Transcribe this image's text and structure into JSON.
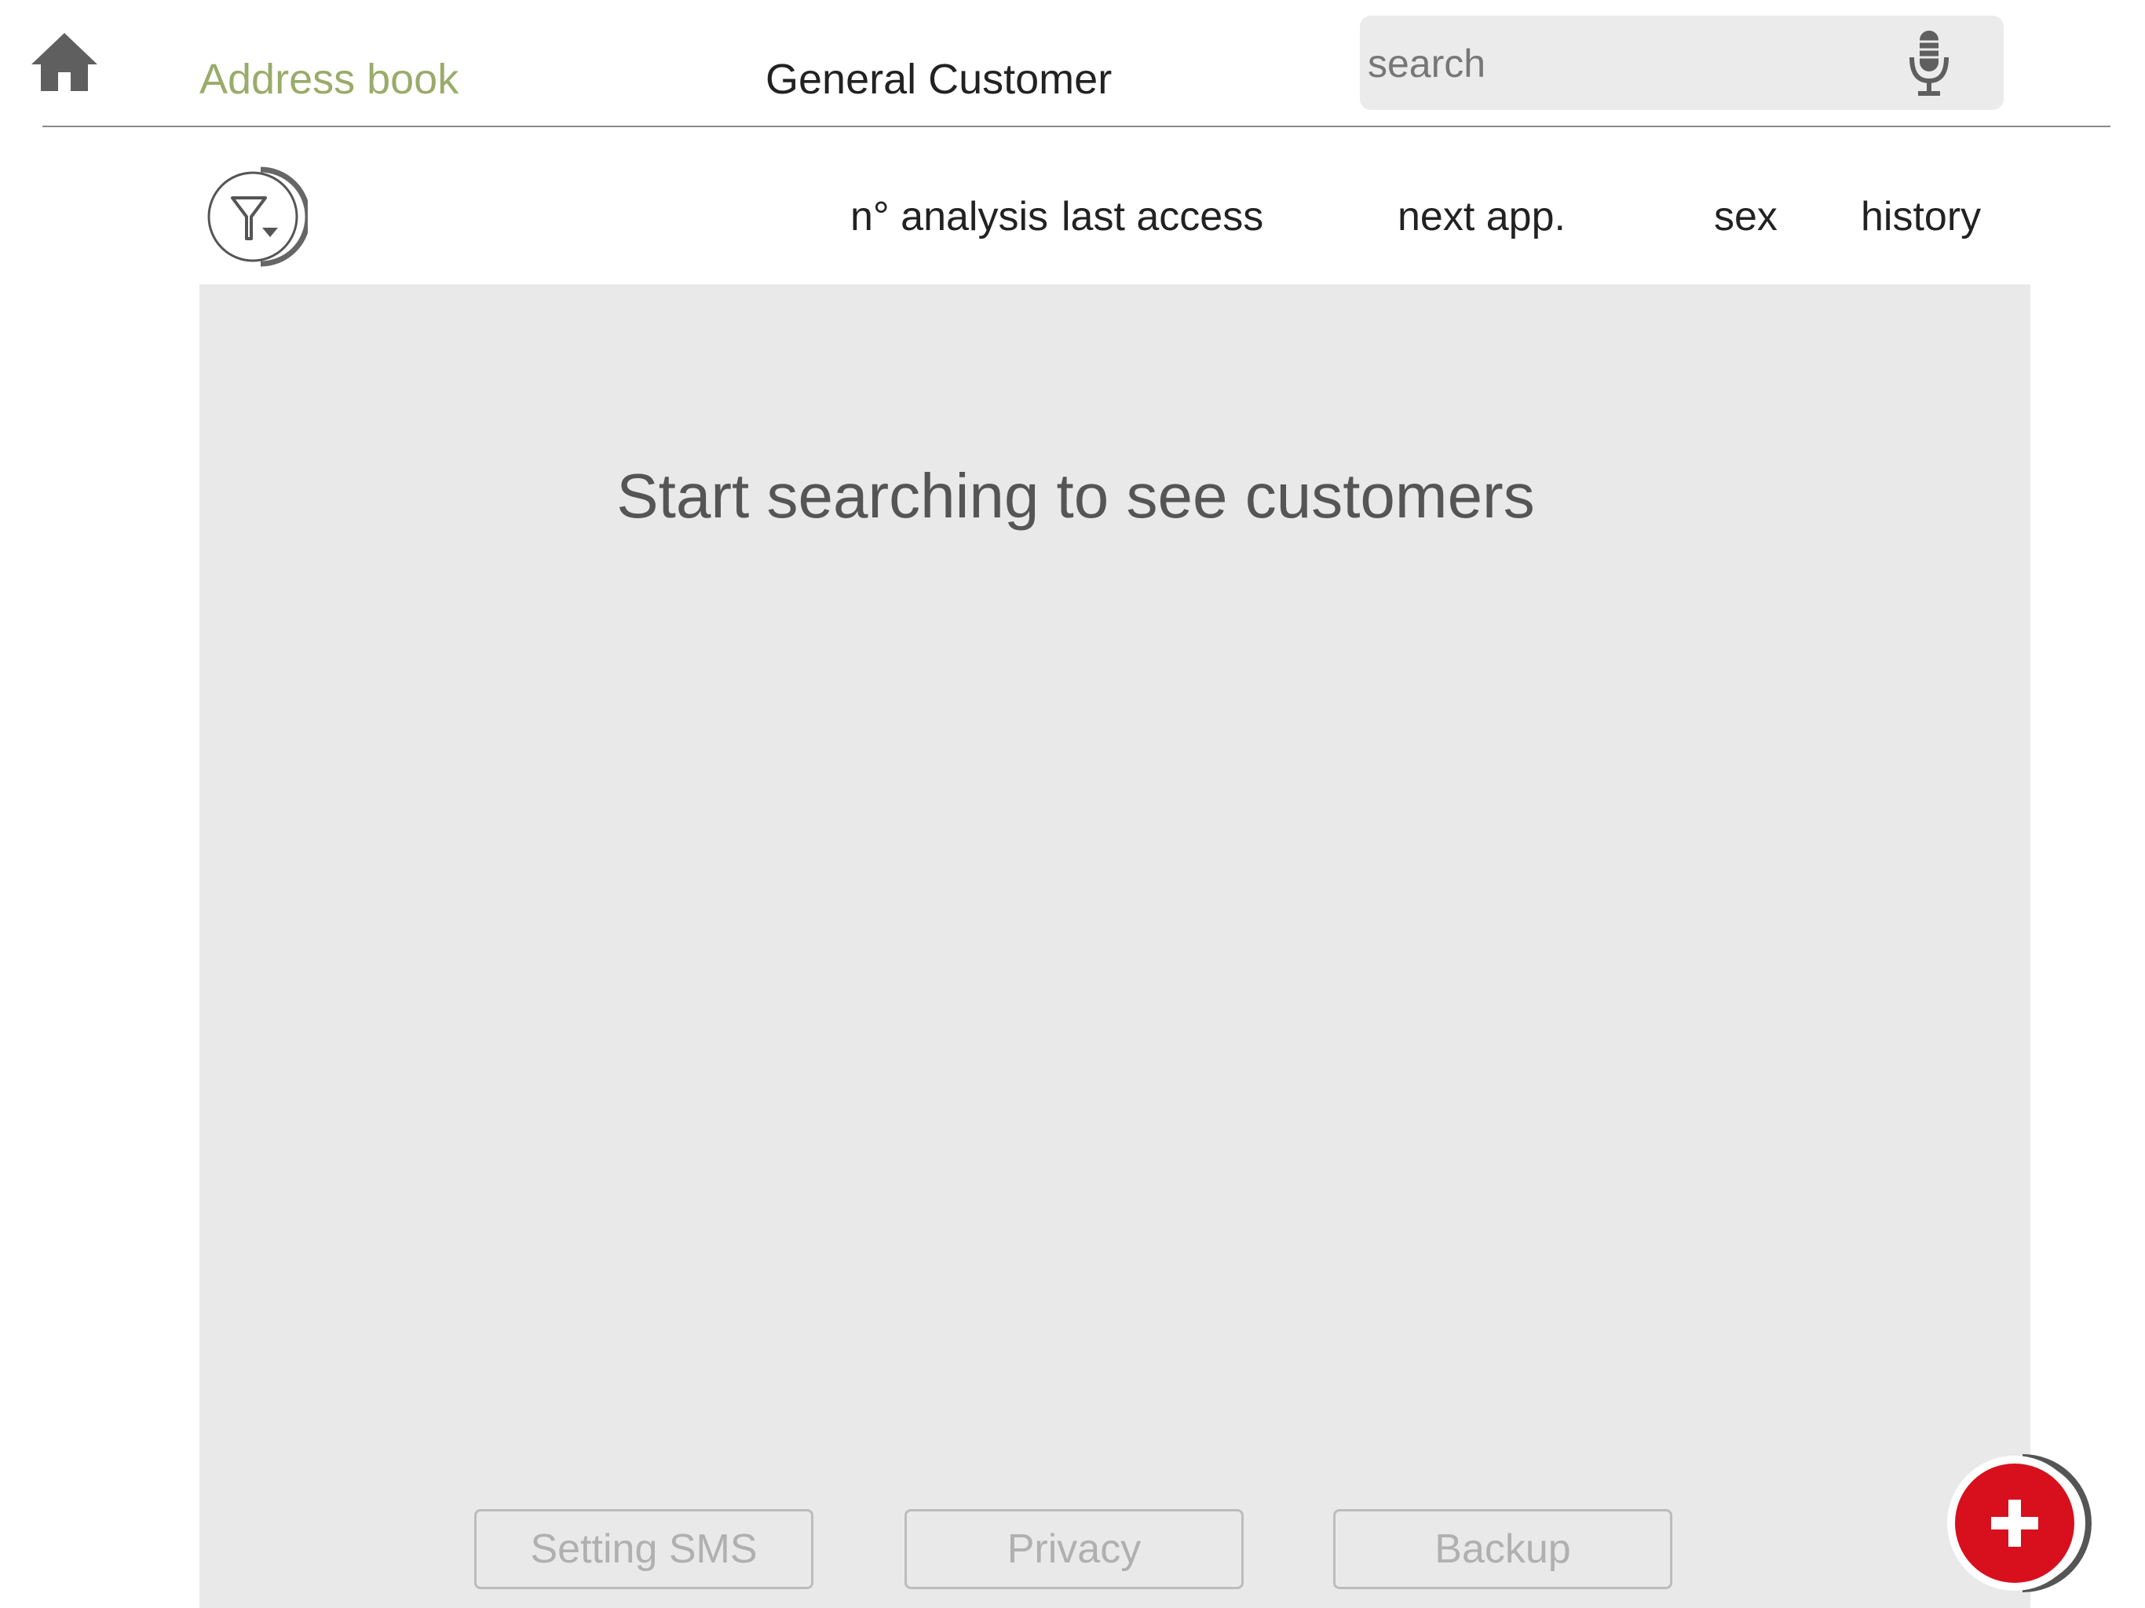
{
  "header": {
    "home_icon": "home-icon",
    "address_book_label": "Address book",
    "address_book_color": "#9aab6a",
    "customer_label": "General Customer",
    "search": {
      "placeholder": "search",
      "value": "",
      "mic_icon": "microphone-icon"
    }
  },
  "columns": {
    "filter_icon": "filter-icon",
    "headers": [
      "n° analysis",
      "last access",
      "next app.",
      "sex",
      "history"
    ]
  },
  "content": {
    "empty_message": "Start searching to see customers",
    "buttons": {
      "setting_sms": "Setting SMS",
      "privacy": "Privacy",
      "backup": "Backup"
    }
  },
  "fab": {
    "icon": "plus-icon",
    "color": "#d8101e"
  }
}
